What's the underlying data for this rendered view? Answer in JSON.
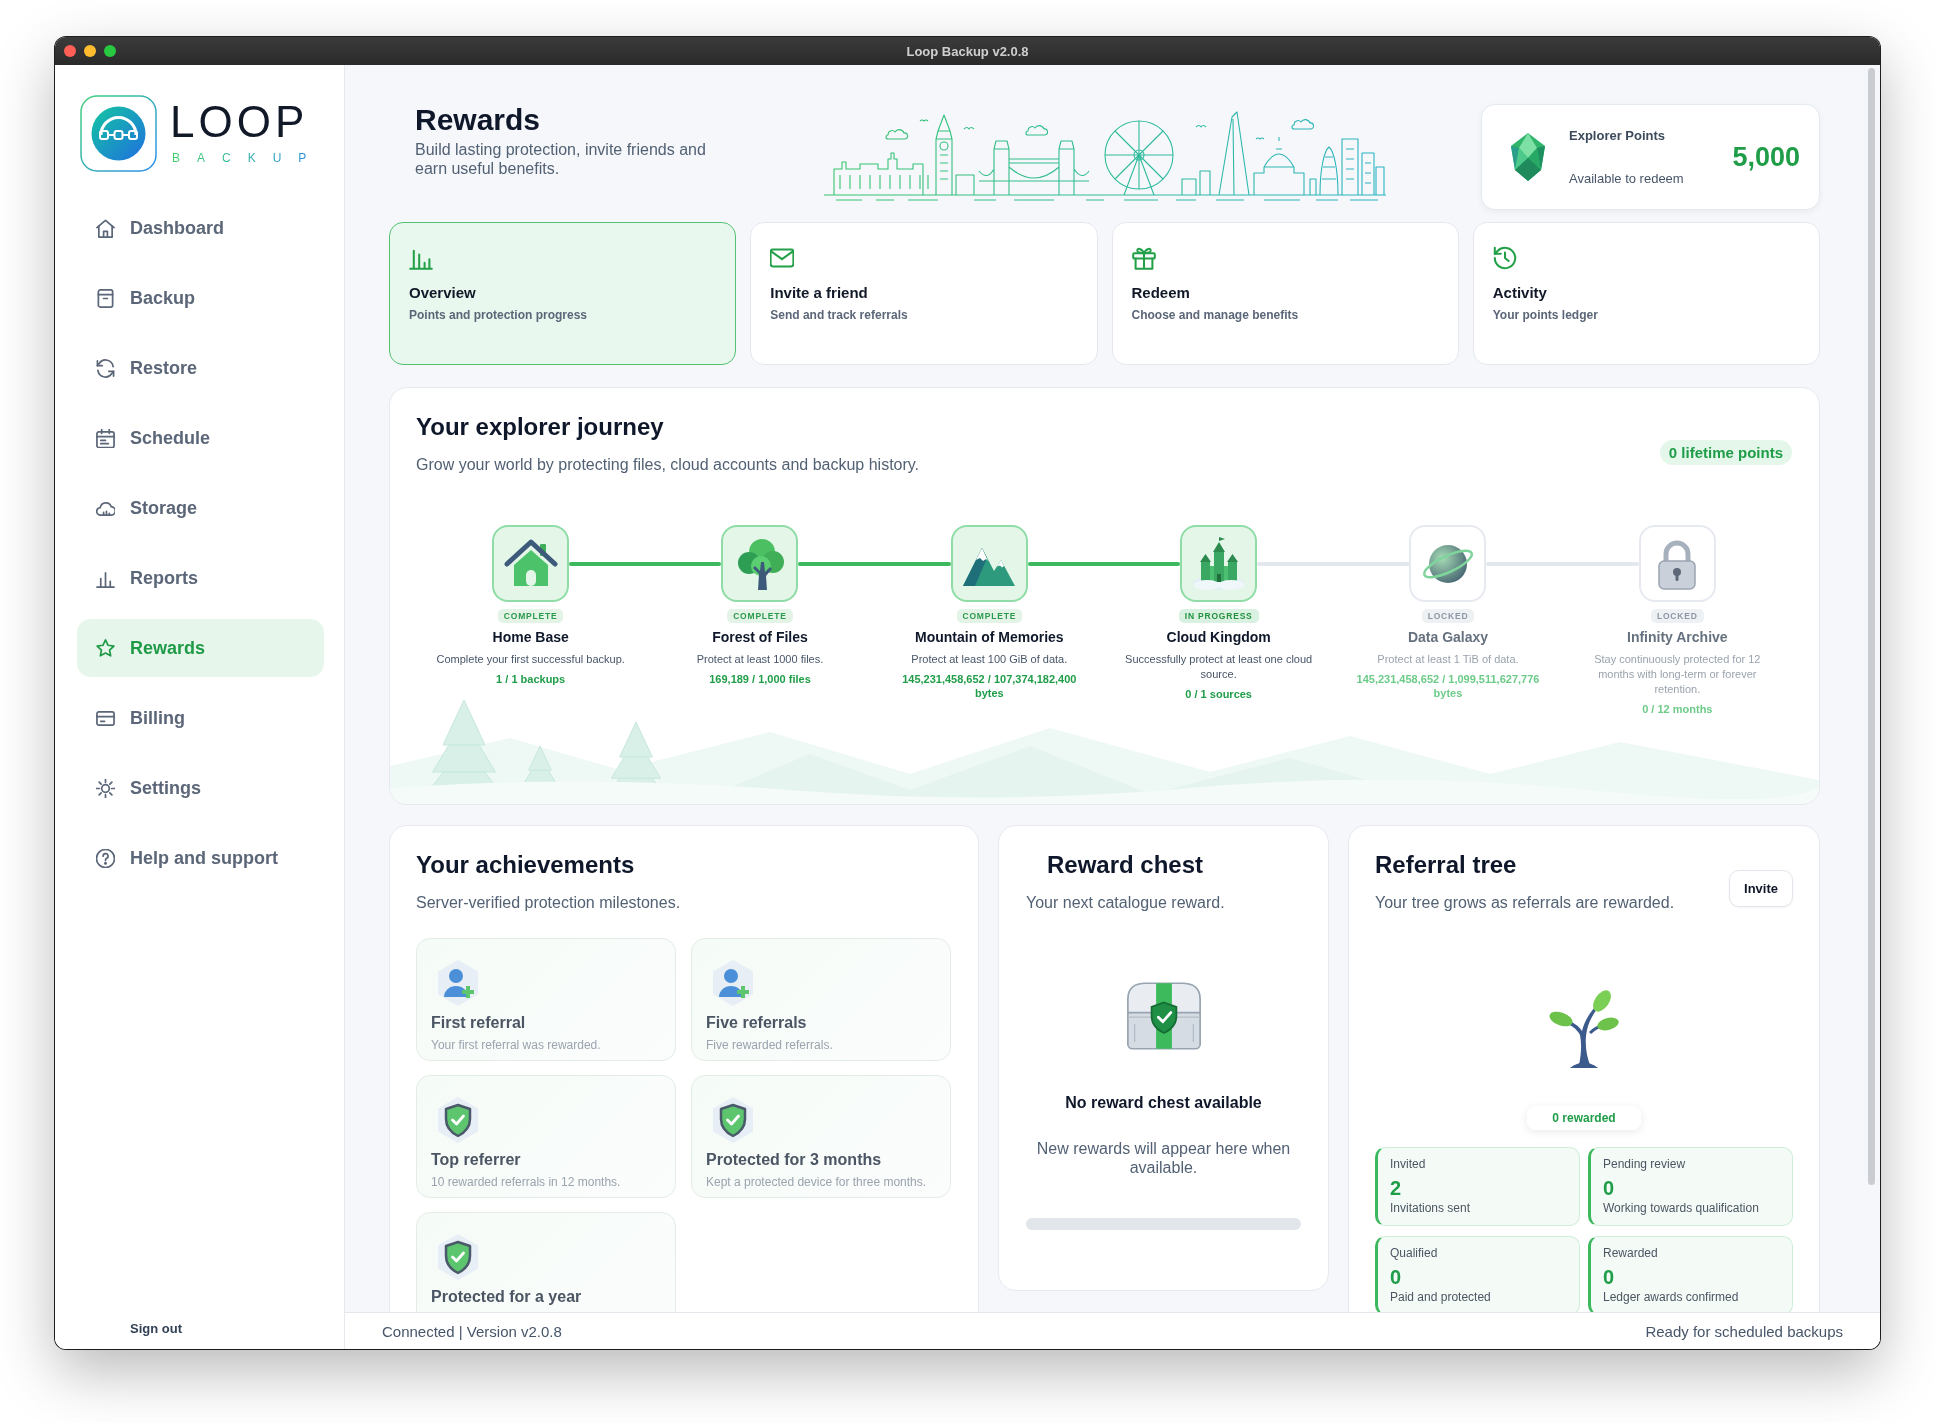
{
  "window": {
    "title": "Loop Backup v2.0.8"
  },
  "sidebar": {
    "logo": {
      "name": "LOOP",
      "tagline": "BACKUP"
    },
    "items": [
      {
        "label": "Dashboard",
        "selected": false
      },
      {
        "label": "Backup",
        "selected": false
      },
      {
        "label": "Restore",
        "selected": false
      },
      {
        "label": "Schedule",
        "selected": false
      },
      {
        "label": "Storage",
        "selected": false
      },
      {
        "label": "Reports",
        "selected": false
      },
      {
        "label": "Rewards",
        "selected": true
      },
      {
        "label": "Billing",
        "selected": false
      },
      {
        "label": "Settings",
        "selected": false
      },
      {
        "label": "Help and support",
        "selected": false
      }
    ],
    "sign_out": "Sign out"
  },
  "header": {
    "title": "Rewards",
    "subtitle": "Build lasting protection, invite friends and earn useful benefits."
  },
  "points": {
    "label": "Explorer Points",
    "caption": "Available to redeem",
    "value": "5,000"
  },
  "tabs": [
    {
      "title": "Overview",
      "subtitle": "Points and protection progress",
      "selected": true
    },
    {
      "title": "Invite a friend",
      "subtitle": "Send and track referrals",
      "selected": false
    },
    {
      "title": "Redeem",
      "subtitle": "Choose and manage benefits",
      "selected": false
    },
    {
      "title": "Activity",
      "subtitle": "Your points ledger",
      "selected": false
    }
  ],
  "journey": {
    "title": "Your explorer journey",
    "subtitle": "Grow your world by protecting files, cloud accounts and backup history.",
    "badge": "0 lifetime points",
    "milestones": [
      {
        "complete": true,
        "locked": false,
        "badge": "COMPLETE",
        "name": "Home Base",
        "description": "Complete your first successful backup.",
        "progress": "1 / 1 backups"
      },
      {
        "complete": true,
        "locked": false,
        "badge": "COMPLETE",
        "name": "Forest of Files",
        "description": "Protect at least 1000 files.",
        "progress": "169,189 / 1,000 files"
      },
      {
        "complete": true,
        "locked": false,
        "badge": "COMPLETE",
        "name": "Mountain of Memories",
        "description": "Protect at least 100 GiB of data.",
        "progress": "145,231,458,652 / 107,374,182,400 bytes"
      },
      {
        "complete": false,
        "locked": false,
        "badge": "IN PROGRESS",
        "name": "Cloud Kingdom",
        "description": "Successfully protect at least one cloud source.",
        "progress": "0 / 1 sources"
      },
      {
        "complete": false,
        "locked": true,
        "badge": "LOCKED",
        "name": "Data Galaxy",
        "description": "Protect at least 1 TiB of data.",
        "progress": "145,231,458,652 / 1,099,511,627,776 bytes"
      },
      {
        "complete": false,
        "locked": true,
        "badge": "LOCKED",
        "name": "Infinity Archive",
        "description": "Stay continuously protected for 12 months with long-term or forever retention.",
        "progress": "0 / 12 months"
      }
    ]
  },
  "achievements": {
    "title": "Your achievements",
    "subtitle": "Server-verified protection milestones.",
    "items": [
      {
        "kind": "referral",
        "title": "First referral",
        "description": "Your first referral was rewarded."
      },
      {
        "kind": "referral",
        "title": "Five referrals",
        "description": "Five rewarded referrals."
      },
      {
        "kind": "milestone",
        "title": "Top referrer",
        "description": "10 rewarded referrals in 12 months."
      },
      {
        "kind": "milestone",
        "title": "Protected for 3 months",
        "description": "Kept a protected device for three months."
      },
      {
        "kind": "milestone",
        "title": "Protected for a year"
      }
    ]
  },
  "reward_chest": {
    "title": "Reward chest",
    "subtitle": "Your next catalogue reward.",
    "empty_title": "No reward chest available",
    "empty_text": "New rewards will appear here when available."
  },
  "referral_tree": {
    "title": "Referral tree",
    "subtitle": "Your tree grows as referrals are rewarded.",
    "invite_button": "Invite",
    "rewarded": "0 rewarded",
    "stats": [
      {
        "label": "Invited",
        "value": "2",
        "caption": "Invitations sent"
      },
      {
        "label": "Pending review",
        "value": "0",
        "caption": "Working towards qualification"
      },
      {
        "label": "Qualified",
        "value": "0",
        "caption": "Paid and protected"
      },
      {
        "label": "Rewarded",
        "value": "0",
        "caption": "Ledger awards confirmed"
      }
    ]
  },
  "status_bar": {
    "left": "Connected | Version v2.0.8",
    "right": "Ready for scheduled backups"
  }
}
